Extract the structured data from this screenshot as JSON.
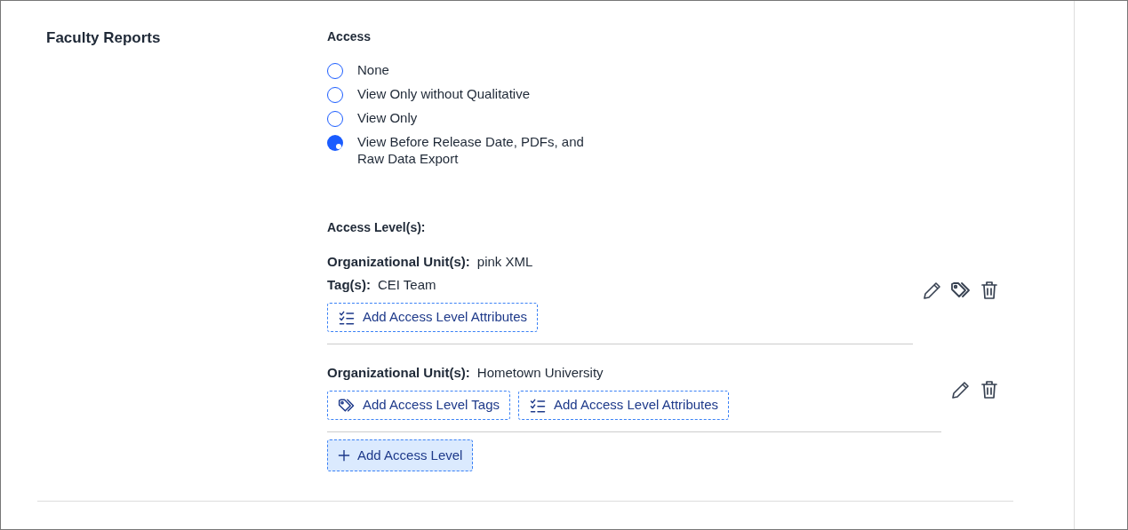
{
  "section_title": "Faculty Reports",
  "access": {
    "label": "Access",
    "options": [
      {
        "label": "None",
        "selected": false
      },
      {
        "label": "View Only without Qualitative",
        "selected": false
      },
      {
        "label": "View Only",
        "selected": false
      },
      {
        "label": "View Before Release Date, PDFs, and Raw Data Export",
        "selected": true
      }
    ]
  },
  "access_levels": {
    "label": "Access Level(s):",
    "items": [
      {
        "fields": [
          {
            "label": "Organizational Unit(s):",
            "value": "pink XML"
          },
          {
            "label": "Tag(s):",
            "value": "CEI Team"
          }
        ],
        "buttons": [
          {
            "kind": "attributes",
            "label": "Add Access Level Attributes"
          }
        ],
        "actions": [
          {
            "kind": "edit"
          },
          {
            "kind": "tags"
          },
          {
            "kind": "delete"
          }
        ]
      },
      {
        "fields": [
          {
            "label": "Organizational Unit(s):",
            "value": "Hometown University"
          }
        ],
        "buttons": [
          {
            "kind": "tags",
            "label": "Add Access Level Tags"
          },
          {
            "kind": "attributes",
            "label": "Add Access Level Attributes"
          }
        ],
        "actions": [
          {
            "kind": "edit"
          },
          {
            "kind": "delete"
          }
        ]
      }
    ],
    "add_button": {
      "label": "Add Access Level"
    }
  }
}
